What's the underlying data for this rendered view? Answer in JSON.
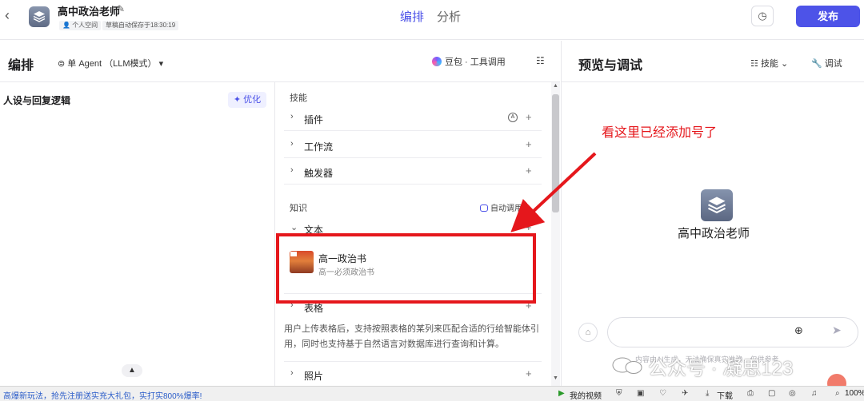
{
  "header": {
    "bot_title": "高中政治老师",
    "tags": [
      "个人空间",
      "草稿自动保存于18:30:19"
    ],
    "tabs": [
      {
        "label": "编排",
        "active": true
      },
      {
        "label": "分析",
        "active": false
      }
    ],
    "publish_label": "发布"
  },
  "left_header": {
    "title": "编排",
    "agent_mode": "单 Agent （LLM模式）",
    "model": "豆包 · 工具调用"
  },
  "persona": {
    "title": "人设与回复逻辑",
    "optimize_label": "优化"
  },
  "skills": {
    "section": "技能",
    "items": [
      {
        "label": "插件"
      },
      {
        "label": "工作流"
      },
      {
        "label": "触发器"
      }
    ]
  },
  "knowledge": {
    "section": "知识",
    "auto_call": "自动调用",
    "text_group": "文本",
    "item": {
      "name": "高一政治书",
      "desc": "高一必须政治书"
    },
    "table_group": "表格",
    "table_desc": "用户上传表格后，支持按照表格的某列来匹配合适的行给智能体引用，同时也支持基于自然语言对数据库进行查询和计算。",
    "photo_group": "照片"
  },
  "preview": {
    "title": "预览与调试",
    "skill_label": "技能",
    "debug_label": "调试",
    "bot_name": "高中政治老师",
    "disclaimer": "内容由AI生成，无法确保真实准确，仅供参考"
  },
  "annotation": {
    "text": "看这里已经添加号了",
    "color": "#e5171c"
  },
  "watermark": {
    "text": "公众号 · 凝思123"
  },
  "statusbar": {
    "ad": "高爆新玩法，抢先注册送实充大礼包，实打实800%爆率!",
    "my_video": "我的视频",
    "download": "下载",
    "zoom": "100%"
  }
}
